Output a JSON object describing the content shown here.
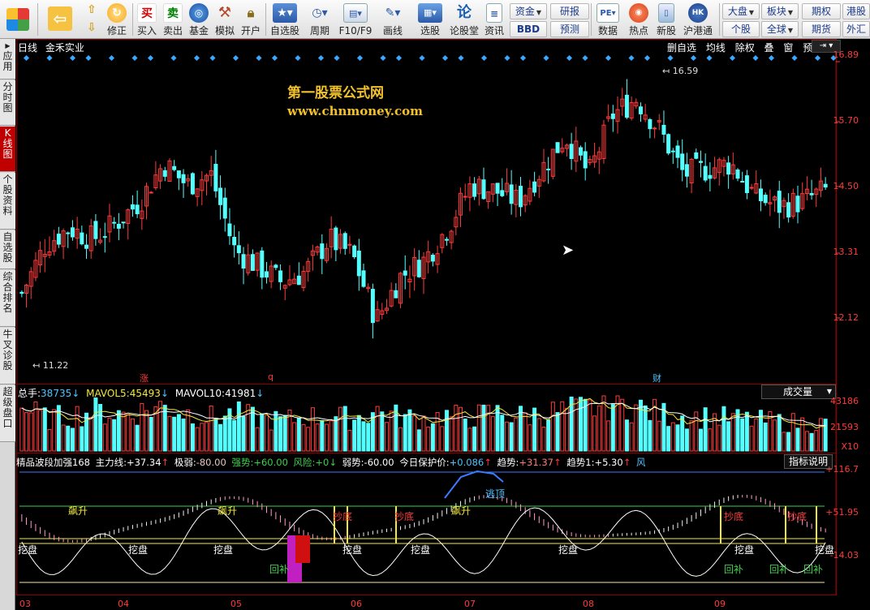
{
  "toolbar": {
    "items": [
      {
        "label": "",
        "icon": "back-arrow-icon"
      },
      {
        "label": "修正",
        "icon": "refresh-icon"
      },
      {
        "label": "买入",
        "icon": "buy-icon",
        "glyph": "买",
        "color": "#d00000"
      },
      {
        "label": "卖出",
        "icon": "sell-icon",
        "glyph": "卖",
        "color": "#008000"
      },
      {
        "label": "基金",
        "icon": "fund-icon"
      },
      {
        "label": "模拟",
        "icon": "hammer-icon"
      },
      {
        "label": "开户",
        "icon": "lock-icon"
      },
      {
        "label": "自选股",
        "icon": "star-icon"
      },
      {
        "label": "周期",
        "icon": "clock-icon"
      },
      {
        "label": "F10/F9",
        "icon": "f10-icon"
      },
      {
        "label": "画线",
        "icon": "pen-icon"
      },
      {
        "label": "选股",
        "icon": "picker-icon"
      },
      {
        "label": "论股堂",
        "icon": "forum-icon",
        "glyph": "论"
      },
      {
        "label": "资讯",
        "icon": "news-icon"
      },
      {
        "label": "数据",
        "icon": "pe-icon",
        "glyph": "PE"
      },
      {
        "label": "热点",
        "icon": "hot-icon"
      },
      {
        "label": "新股",
        "icon": "newstock-icon"
      },
      {
        "label": "沪港通",
        "icon": "sse-hkex-icon",
        "glyph": "HK"
      }
    ],
    "boxes": {
      "zijin": "资金",
      "bbd": "BBD",
      "yanbao": "研报",
      "yuce": "预测",
      "dapan": "大盘",
      "bankuai": "板块",
      "qihuo": "期权",
      "ganggu": "港股",
      "gegu": "个股",
      "quanqiu": "全球",
      "qihuo2": "期货",
      "waihui": "外汇"
    }
  },
  "sidebar": {
    "items": [
      "应用",
      "分时图",
      "K线图",
      "个股资料",
      "自选股",
      "综合排名",
      "牛叉诊股",
      "超级盘口"
    ],
    "active": 2
  },
  "kline": {
    "period": "日线",
    "stock_name": "金禾实业",
    "buttons": [
      "删自选",
      "均线",
      "除权",
      "叠",
      "窗",
      "预测"
    ],
    "watermark1": "第一股票公式网",
    "watermark2": "www.chnmoney.com",
    "high_label": "16.59",
    "low_label": "11.22",
    "price_ticks": [
      "16.89",
      "15.70",
      "14.50",
      "13.31",
      "12.12"
    ],
    "event_marks": [
      "涨",
      "q",
      "财"
    ]
  },
  "volume": {
    "title": "总手:",
    "total": "38735",
    "ma5_label": "MAVOL5:",
    "ma5": "45493",
    "ma10_label": "MAVOL10:",
    "ma10": "41981",
    "selector": "成交量",
    "ticks": [
      "43186",
      "21593",
      "X10"
    ]
  },
  "indicator": {
    "name": "精品波段加强168",
    "values": [
      {
        "k": "主力线:",
        "v": "+37.34",
        "arrow": "↑"
      },
      {
        "k": "极弱:",
        "v": "-80.00",
        "arrow": ""
      },
      {
        "k": "强势:",
        "v": "+60.00",
        "arrow": ""
      },
      {
        "k": "风险:",
        "v": "+0",
        "arrow": "↓"
      },
      {
        "k": "弱势:",
        "v": "-60.00",
        "arrow": ""
      },
      {
        "k": "今日保护价:",
        "v": "+0.086",
        "arrow": "↑"
      },
      {
        "k": "趋势:",
        "v": "+31.37",
        "arrow": "↑"
      },
      {
        "k": "趋势1:",
        "v": "+5.30",
        "arrow": "↑"
      },
      {
        "k": "风",
        "v": "",
        "arrow": ""
      }
    ],
    "help_button": "指标说明",
    "ticks": [
      "+116.7",
      "+51.95",
      "-14.03"
    ],
    "signals": {
      "piaosheng": "飙升",
      "wapan": "挖盘",
      "chaodi": "抄底",
      "taoding": "逃顶",
      "huibu": "回补"
    }
  },
  "xaxis": [
    "03",
    "04",
    "05",
    "06",
    "07",
    "08",
    "09"
  ],
  "chart_data": {
    "type": "candlestick",
    "title": "金禾实业",
    "xlabel": "",
    "ylabel": "",
    "ylim": [
      11.0,
      17.0
    ],
    "yticks": [
      16.89,
      15.7,
      14.5,
      13.31,
      12.12
    ],
    "categories": [
      "03",
      "04",
      "05",
      "06",
      "07",
      "08",
      "09"
    ],
    "series": [
      {
        "name": "",
        "values": [
          12.6,
          13.5,
          13.8,
          13.6,
          13.9,
          14.3,
          15.0,
          14.6,
          14.8,
          13.4,
          13.1,
          12.8,
          13.0,
          13.6,
          13.3,
          12.1,
          12.9,
          13.2,
          13.8,
          14.6,
          14.5,
          14.3,
          14.9,
          15.5,
          14.8,
          15.9,
          16.2,
          15.6,
          14.8,
          14.9,
          15.0,
          14.4,
          14.2,
          14.3,
          14.5
        ]
      },
      {
        "name": "总手",
        "values": [
          38735,
          29000,
          31000,
          36000,
          33000,
          35000,
          40000,
          34000,
          30000,
          33000,
          29000,
          27000,
          30000,
          31000,
          29000,
          36000,
          30000,
          29000,
          31000,
          30000,
          34000,
          31000,
          33000,
          36000,
          38000,
          43000,
          39000,
          33000,
          31000,
          30000,
          29000,
          27000,
          26000,
          25000,
          24000
        ]
      }
    ]
  }
}
